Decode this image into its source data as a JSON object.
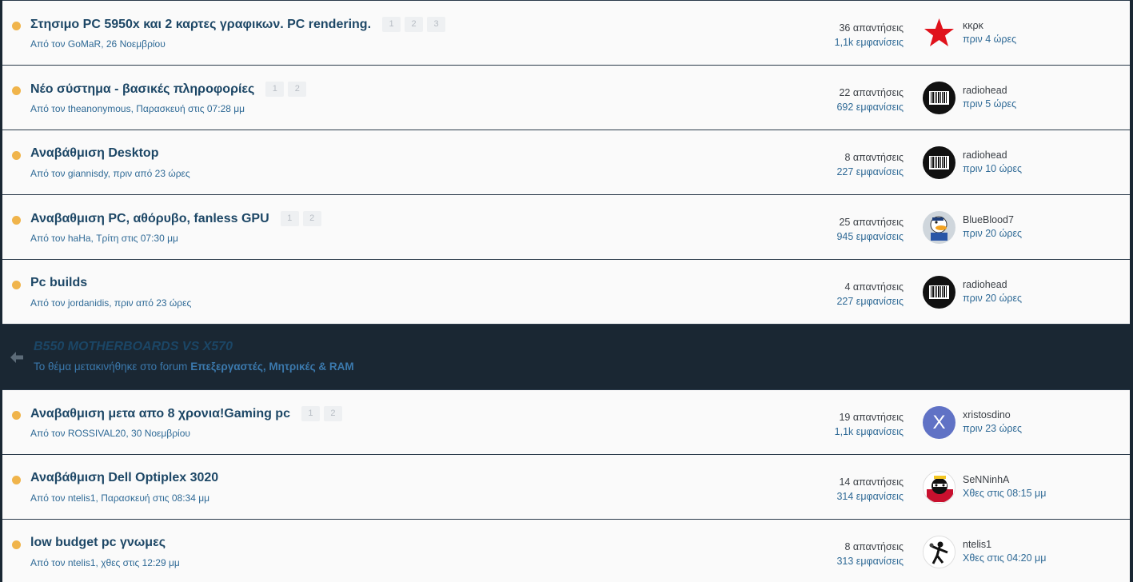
{
  "threads": [
    {
      "title": "Στησιμο PC 5950x και 2 καρτες γραφικων. PC rendering.",
      "pages": [
        "1",
        "2",
        "3"
      ],
      "meta": "Από τον GoMaR, 26 Νοεμβρίου",
      "replies": "36 απαντήσεις",
      "views": "1,1k εμφανίσεις",
      "avatar": "red-star-avatar",
      "last_user": "κκρκ",
      "last_time": "πριν 4 ώρες"
    },
    {
      "title": "Νέο σύστημα - βασικές πληροφορίες",
      "pages": [
        "1",
        "2"
      ],
      "meta": "Από τον theanonymous, Παρασκευή στις 07:28 μμ",
      "replies": "22 απαντήσεις",
      "views": "692 εμφανίσεις",
      "avatar": "barcode-avatar",
      "last_user": "radiohead",
      "last_time": "πριν 5 ώρες"
    },
    {
      "title": "Αναβάθμιση Desktop",
      "pages": [],
      "meta": "Από τον giannisdy, πριν από 23 ώρες",
      "replies": "8 απαντήσεις",
      "views": "227 εμφανίσεις",
      "avatar": "barcode-avatar",
      "last_user": "radiohead",
      "last_time": "πριν 10 ώρες"
    },
    {
      "title": "Αναβαθμιση PC, αθόρυβο, fanless GPU",
      "pages": [
        "1",
        "2"
      ],
      "meta": "Από τον haHa, Τρίτη στις 07:30 μμ",
      "replies": "25 απαντήσεις",
      "views": "945 εμφανίσεις",
      "avatar": "duck-avatar",
      "last_user": "BlueBlood7",
      "last_time": "πριν 20 ώρες"
    },
    {
      "title": "Pc builds",
      "pages": [],
      "meta": "Από τον jordanidis, πριν από 23 ώρες",
      "replies": "4 απαντήσεις",
      "views": "227 εμφανίσεις",
      "avatar": "barcode-avatar",
      "last_user": "radiohead",
      "last_time": "πριν 20 ώρες"
    }
  ],
  "moved": {
    "title": "B550 MOTHERBOARDS VS X570",
    "note_prefix": "Το θέμα μετακινήθηκε στο forum",
    "forum": "Επεξεργαστές, Μητρικές & RAM"
  },
  "threads2": [
    {
      "title": "Αναβαθμιση μετα απο 8 χρονια!Gaming pc",
      "pages": [
        "1",
        "2"
      ],
      "meta": "Από τον ROSSIVAL20, 30 Νοεμβρίου",
      "replies": "19 απαντήσεις",
      "views": "1,1k εμφανίσεις",
      "avatar": "letter-x-avatar",
      "avatar_letter": "X",
      "last_user": "xristosdino",
      "last_time": "πριν 23 ώρες"
    },
    {
      "title": "Αναβάθμιση Dell Optiplex 3020",
      "pages": [],
      "meta": "Από τον ntelis1, Παρασκευή στις 08:34 μμ",
      "replies": "14 απαντήσεις",
      "views": "314 εμφανίσεις",
      "avatar": "cartoon-avatar",
      "last_user": "SeNNinhA",
      "last_time": "Χθες στις 08:15 μμ"
    },
    {
      "title": "low budget pc γνωμες",
      "pages": [],
      "meta": "Από τον ntelis1, χθες στις 12:29 μμ",
      "replies": "8 απαντήσεις",
      "views": "313 εμφανίσεις",
      "avatar": "flower-thrower-avatar",
      "last_user": "ntelis1",
      "last_time": "Χθες στις 04:20 μμ"
    }
  ],
  "colors": {
    "unread_dot": "#f0b44b",
    "title": "#1d4766",
    "link": "#2f6a96",
    "background": "#1a2733"
  }
}
